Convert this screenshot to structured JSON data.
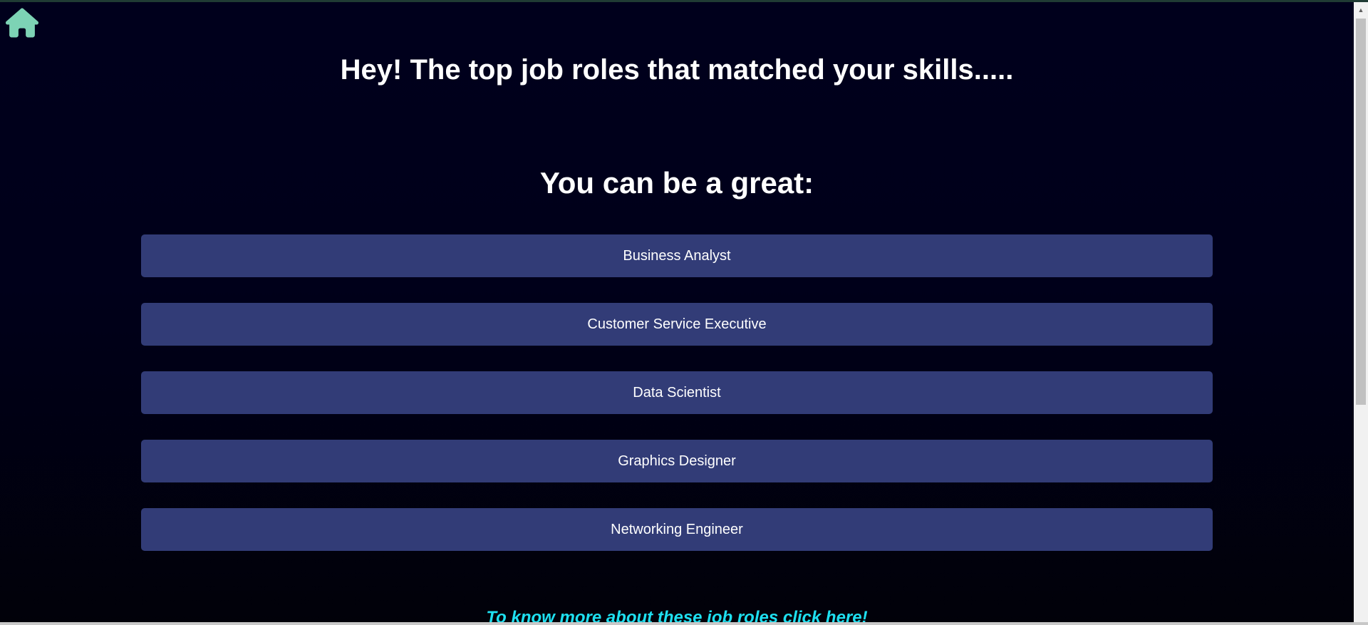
{
  "header": {
    "home_icon": "home-icon",
    "home_icon_color": "#7dd3b5"
  },
  "main": {
    "title": "Hey! The top job roles that matched your skills.....",
    "subtitle": "You can be a great:",
    "roles": [
      "Business Analyst",
      "Customer Service Executive",
      "Data Scientist",
      "Graphics Designer",
      "Networking Engineer"
    ],
    "more_link": "To know more about these job roles click here!"
  },
  "colors": {
    "background": "#00001a",
    "role_button": "#323c77",
    "link": "#1ee0f0"
  }
}
